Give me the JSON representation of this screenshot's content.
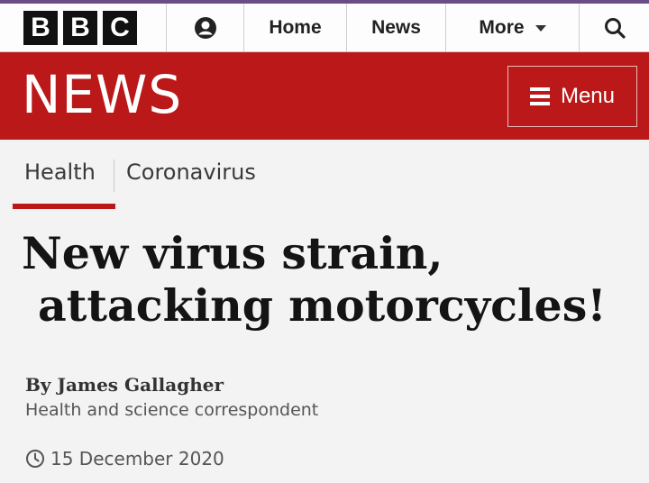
{
  "nav": {
    "logo_letters": [
      "B",
      "B",
      "C"
    ],
    "home_label": "Home",
    "news_label": "News",
    "more_label": "More"
  },
  "banner": {
    "title": "NEWS",
    "menu_label": "Menu"
  },
  "tabs": [
    {
      "label": "Health",
      "active": true
    },
    {
      "label": "Coronavirus",
      "active": false
    }
  ],
  "article": {
    "headline_line1": "New virus strain,",
    "headline_line2": "attacking motorcycles!",
    "byline": "By James Gallagher",
    "role": "Health and science correspondent",
    "date": "15 December 2020"
  },
  "colors": {
    "brand_red": "#bb1919",
    "nav_accent": "#6b4d86"
  },
  "icons": [
    "account-icon",
    "chevron-down-icon",
    "search-icon",
    "hamburger-icon",
    "clock-icon"
  ]
}
